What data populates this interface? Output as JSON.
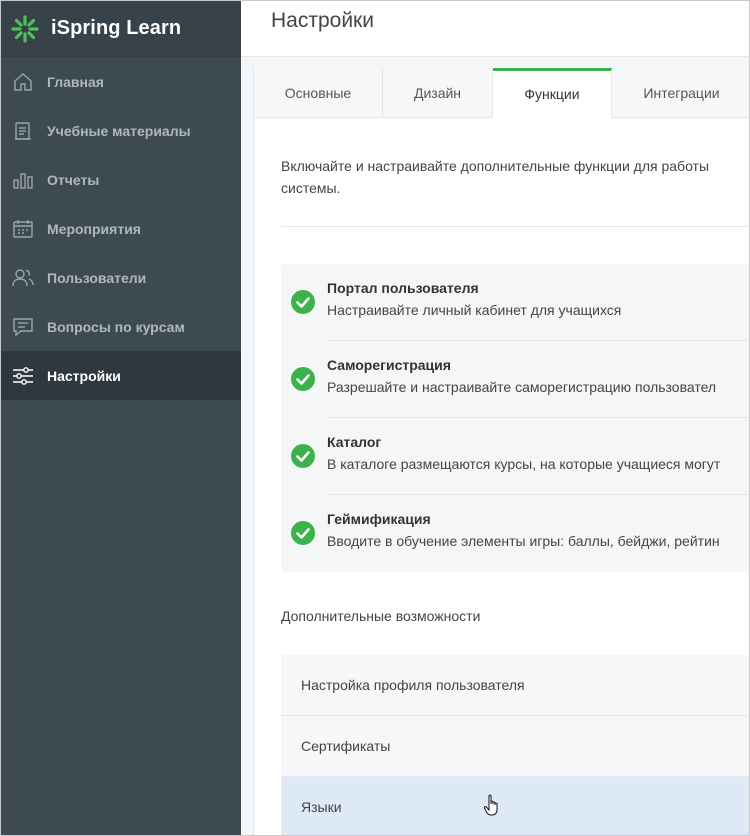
{
  "app": {
    "brand": "iSpring Learn",
    "accent": "#37b34a"
  },
  "sidebar": {
    "items": [
      {
        "label": "Главная",
        "icon": "home-icon",
        "active": false
      },
      {
        "label": "Учебные материалы",
        "icon": "document-icon",
        "active": false
      },
      {
        "label": "Отчеты",
        "icon": "bar-chart-icon",
        "active": false
      },
      {
        "label": "Мероприятия",
        "icon": "calendar-icon",
        "active": false
      },
      {
        "label": "Пользователи",
        "icon": "users-icon",
        "active": false
      },
      {
        "label": "Вопросы по курсам",
        "icon": "chat-icon",
        "active": false
      },
      {
        "label": "Настройки",
        "icon": "sliders-icon",
        "active": true
      }
    ]
  },
  "header": {
    "title": "Настройки"
  },
  "tabs": [
    {
      "label": "Основные",
      "active": false
    },
    {
      "label": "Дизайн",
      "active": false
    },
    {
      "label": "Функции",
      "active": true
    },
    {
      "label": "Интеграции",
      "active": false
    }
  ],
  "main": {
    "intro_line1": "Включайте и настраивайте дополнительные функции для работы",
    "intro_line2": "системы.",
    "features": [
      {
        "title": "Портал пользователя",
        "description": "Настраивайте личный кабинет для учащихся",
        "enabled": true
      },
      {
        "title": "Саморегистрация",
        "description": "Разрешайте и настраивайте саморегистрацию пользовател",
        "enabled": true
      },
      {
        "title": "Каталог",
        "description": "В каталоге размещаются курсы, на которые учащиеся могут",
        "enabled": true
      },
      {
        "title": "Геймификация",
        "description": "Вводите в обучение элементы игры: баллы, бейджи, рейтин",
        "enabled": true
      }
    ],
    "extra_title": "Дополнительные возможности",
    "extras": [
      {
        "label": "Настройка профиля пользователя"
      },
      {
        "label": "Сертификаты"
      },
      {
        "label": "Языки"
      }
    ]
  }
}
